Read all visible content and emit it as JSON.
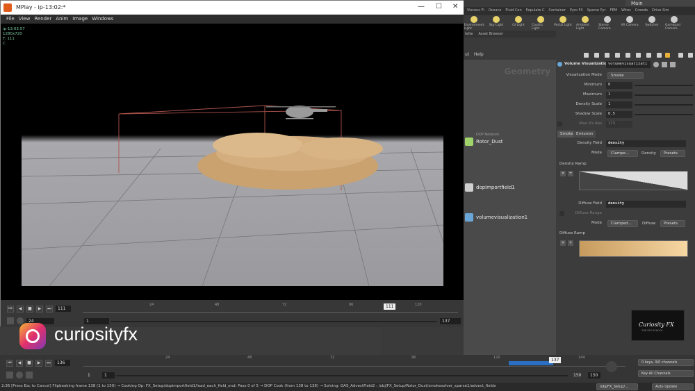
{
  "houdini": {
    "desktop_label": "Main",
    "shelf_tabs": [
      "Viscous Fl",
      "Oceans",
      "Fluid Con",
      "Populate C",
      "Container",
      "Pyro FX",
      "Sparse Pyr",
      "FEM",
      "Wires",
      "Crowds",
      "Drive Sim"
    ],
    "shelf_tools": [
      "Environment Light",
      "Sky Light",
      "GI Light",
      "Caustic Light",
      "Portal Light",
      "Ambient Light",
      "Stereo Camera",
      "VR Camera",
      "Switcher",
      "Gamepad Camera"
    ],
    "pane_tabs": [
      "lette",
      "Asset Browser"
    ],
    "net_menu": [
      "ut",
      "Help"
    ],
    "context_title": "Geometry",
    "nodes": [
      {
        "label": "Rotor_Dust",
        "sub": "DOP Network",
        "color": "#9fd36b"
      },
      {
        "label": "dopimportfield1",
        "sub": "",
        "color": "#cfcfcf"
      },
      {
        "label": "volumevisualization1",
        "sub": "",
        "color": "#6aa7d8"
      }
    ]
  },
  "params": {
    "node_type": "Volume Visualization",
    "node_name": "volumevisualizati",
    "rows": [
      {
        "label": "Visualization Mode",
        "value": "Smoke"
      },
      {
        "label": "Minimum",
        "value": "0"
      },
      {
        "label": "Maximum",
        "value": "1"
      },
      {
        "label": "Density Scale",
        "value": "1"
      },
      {
        "label": "Shadow Scale",
        "value": "0.5"
      },
      {
        "label": "Max Vis Res",
        "value": "173"
      }
    ],
    "tabs": [
      "Smoke",
      "Emission"
    ],
    "density_field_label": "Density Field",
    "density_field_value": "density",
    "mode_label": "Mode",
    "density_mode": "Clampe...",
    "density_word": "Density",
    "presets": "Presets",
    "density_ramp_label": "Density Ramp",
    "diffuse_field_label": "Diffuse Field",
    "diffuse_field_value": "density",
    "diffuse_range_label": "Diffuse Range",
    "diffuse_mode": "Clamped...",
    "diffuse_word": "Diffuse",
    "diffuse_ramp_label": "Diffuse Ramp"
  },
  "logo": {
    "title": "Curiosity FX",
    "sub": "THE VFX SCHOOL"
  },
  "mplay": {
    "title": "MPlay - ip-13:02:*",
    "menu": [
      "File",
      "View",
      "Render",
      "Anim",
      "Image",
      "Windows"
    ],
    "info": [
      "ip-13:03:57",
      "1280x720",
      "F: 111",
      "C"
    ],
    "frame": "111",
    "ticks": [
      "24",
      "48",
      "72",
      "96",
      "120"
    ],
    "marker": "111",
    "fps": "24",
    "range_start": "1",
    "range_end": "137"
  },
  "social": {
    "handle": "curiosityfx"
  },
  "playbar": {
    "frame": "136",
    "ticks": [
      "24",
      "48",
      "72",
      "96",
      "120",
      "144"
    ],
    "marker": "137",
    "start": "1",
    "start2": "1",
    "end": "150",
    "end2": "150",
    "keys_label": "0 keys, 0/0 channels",
    "key_all": "Key All Channels",
    "scene_path": "/obj/FX_Setup/...",
    "auto_update": "Auto Update"
  },
  "status": "2:36 [Press Esc to Cancel] Flipbooking frame 138 (1 to 150) → Cooking Op: FX_Setup/dopimportfield1/load_each_field_end: Pass 0 of 5 → DOP Cook (from 138 to 138) → Solving: GAS_AdvectField2 : /obj/FX_Setup/Rotor_Dust/smokesolver_sparse1/advect_fields"
}
